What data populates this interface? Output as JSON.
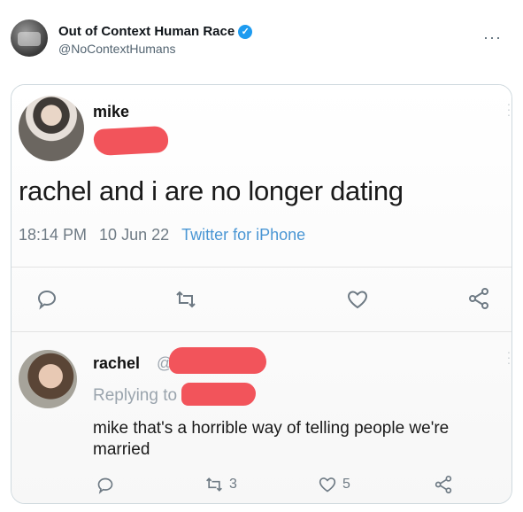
{
  "header": {
    "display_name": "Out of Context Human Race",
    "handle": "@NoContextHumans",
    "more_icon": "more-horizontal-icon",
    "verified_color": "#1d9bf0"
  },
  "embedded": {
    "tweet": {
      "name": "mike",
      "text": "rachel and i are no longer dating",
      "time": "18:14 PM",
      "date": "10 Jun 22",
      "source": "Twitter for iPhone"
    },
    "reply": {
      "name": "rachel",
      "at_fragment": "@",
      "replying_label": "Replying to",
      "text": "mike that's a horrible way of telling people we're married",
      "retweet_count": "3",
      "like_count": "5"
    },
    "redaction_color": "#f2545b",
    "source_color": "#4a96d4"
  }
}
